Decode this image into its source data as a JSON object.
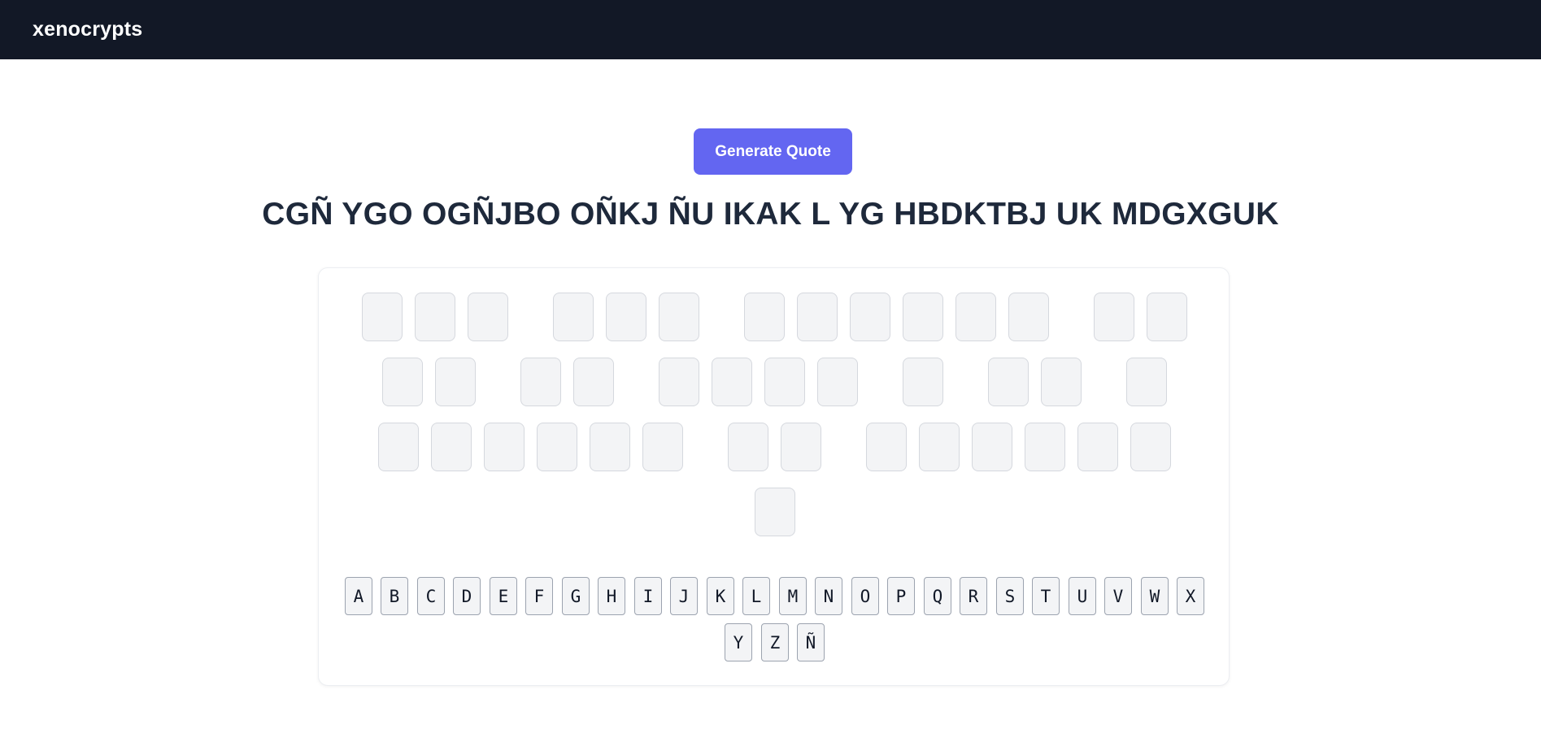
{
  "app": {
    "title": "xenocrypts"
  },
  "actions": {
    "generate_label": "Generate Quote"
  },
  "cipher_text": "CGÑ YGO OGÑJBO OÑKJ ÑU IKAK L YG HBDKTBJ UK MDGXGUK",
  "answer_rows": [
    [
      {
        "word": 1,
        "letters": [
          "",
          "",
          ""
        ]
      },
      {
        "word": 2,
        "letters": [
          "",
          "",
          ""
        ]
      },
      {
        "word": 3,
        "letters": [
          "",
          "",
          "",
          "",
          "",
          ""
        ]
      },
      {
        "word": 4,
        "letters": [
          "",
          ""
        ]
      }
    ],
    [
      {
        "word": 4,
        "letters": [
          "",
          ""
        ]
      },
      {
        "word": 5,
        "letters": [
          "",
          ""
        ]
      },
      {
        "word": 6,
        "letters": [
          "",
          "",
          "",
          ""
        ]
      },
      {
        "word": 7,
        "letters": [
          ""
        ]
      },
      {
        "word": 8,
        "letters": [
          "",
          ""
        ]
      },
      {
        "word": 9,
        "letters": [
          ""
        ]
      }
    ],
    [
      {
        "word": 9,
        "letters": [
          "",
          "",
          "",
          "",
          "",
          ""
        ]
      },
      {
        "word": 10,
        "letters": [
          "",
          ""
        ]
      },
      {
        "word": 11,
        "letters": [
          "",
          "",
          "",
          "",
          "",
          ""
        ]
      }
    ],
    [
      {
        "word": 11,
        "letters": [
          ""
        ]
      }
    ]
  ],
  "alphabet_row1": [
    "A",
    "B",
    "C",
    "D",
    "E",
    "F",
    "G",
    "H",
    "I",
    "J",
    "K",
    "L",
    "M",
    "N",
    "O",
    "P",
    "Q",
    "R",
    "S",
    "T",
    "U",
    "V",
    "W",
    "X"
  ],
  "alphabet_row2": [
    "Y",
    "Z",
    "Ñ"
  ]
}
